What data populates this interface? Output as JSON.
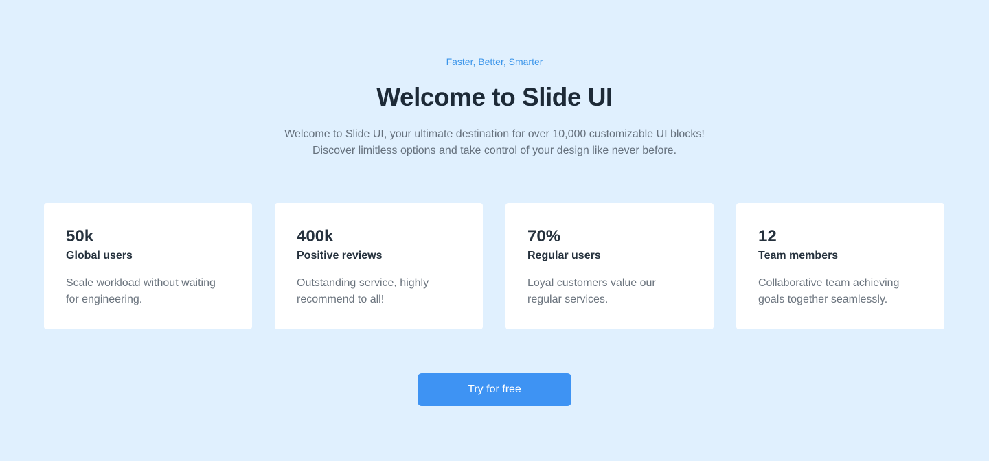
{
  "hero": {
    "eyebrow": "Faster, Better, Smarter",
    "title": "Welcome to Slide UI",
    "subtitle": "Welcome to Slide UI, your ultimate destination for over 10,000 customizable UI blocks! Discover limitless options and take control of your design like never before."
  },
  "stats": [
    {
      "value": "50k",
      "label": "Global users",
      "description": "Scale workload without waiting for engineering."
    },
    {
      "value": "400k",
      "label": "Positive reviews",
      "description": "Outstanding service, highly recommend to all!"
    },
    {
      "value": "70%",
      "label": "Regular users",
      "description": "Loyal customers value our regular services."
    },
    {
      "value": "12",
      "label": "Team members",
      "description": "Collaborative team achieving goals together seamlessly."
    }
  ],
  "cta": {
    "label": "Try for free"
  },
  "colors": {
    "background": "#e0f0fe",
    "accent": "#3e93f3",
    "eyebrow": "#3b95ea",
    "heading": "#1d2a37",
    "muted_text": "#66717d",
    "card": "#ffffff"
  }
}
